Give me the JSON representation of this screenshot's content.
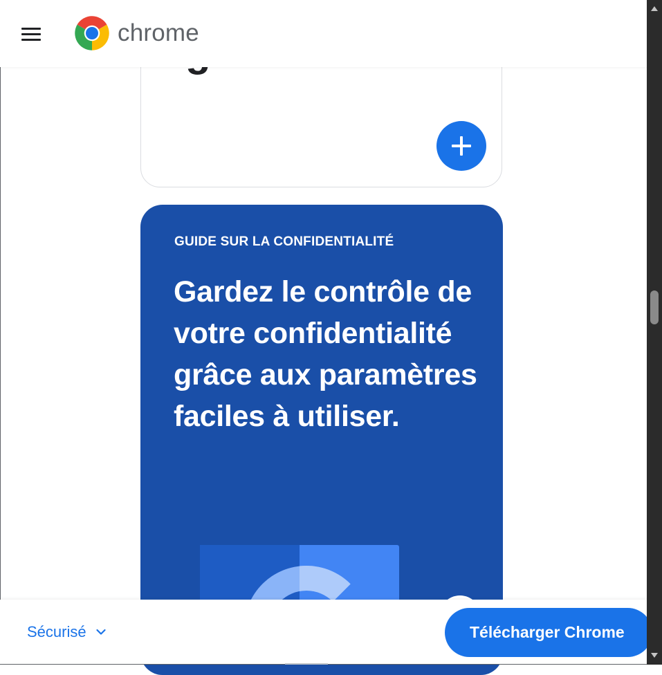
{
  "header": {
    "menu_icon": "hamburger-menu-icon",
    "logo_icon": "chrome-logo-icon",
    "logo_text": "chrome"
  },
  "white_card": {
    "partial_glyph": "g",
    "add_icon": "plus-icon"
  },
  "privacy_card": {
    "eyebrow": "GUIDE SUR LA CONFIDENTIALITÉ",
    "headline": "Gardez le contrôle de votre confidentialité grâce aux paramètres faciles à utiliser.",
    "illustration": "google-g-illustration"
  },
  "bottom_bar": {
    "secure_label": "Sécurisé",
    "secure_chevron": "chevron-down-icon",
    "download_label": "Télécharger Chrome"
  },
  "colors": {
    "accent": "#1a73e8",
    "card_blue": "#1a4fa8",
    "text_dark": "#202124",
    "logo_gray": "#5f6368"
  }
}
